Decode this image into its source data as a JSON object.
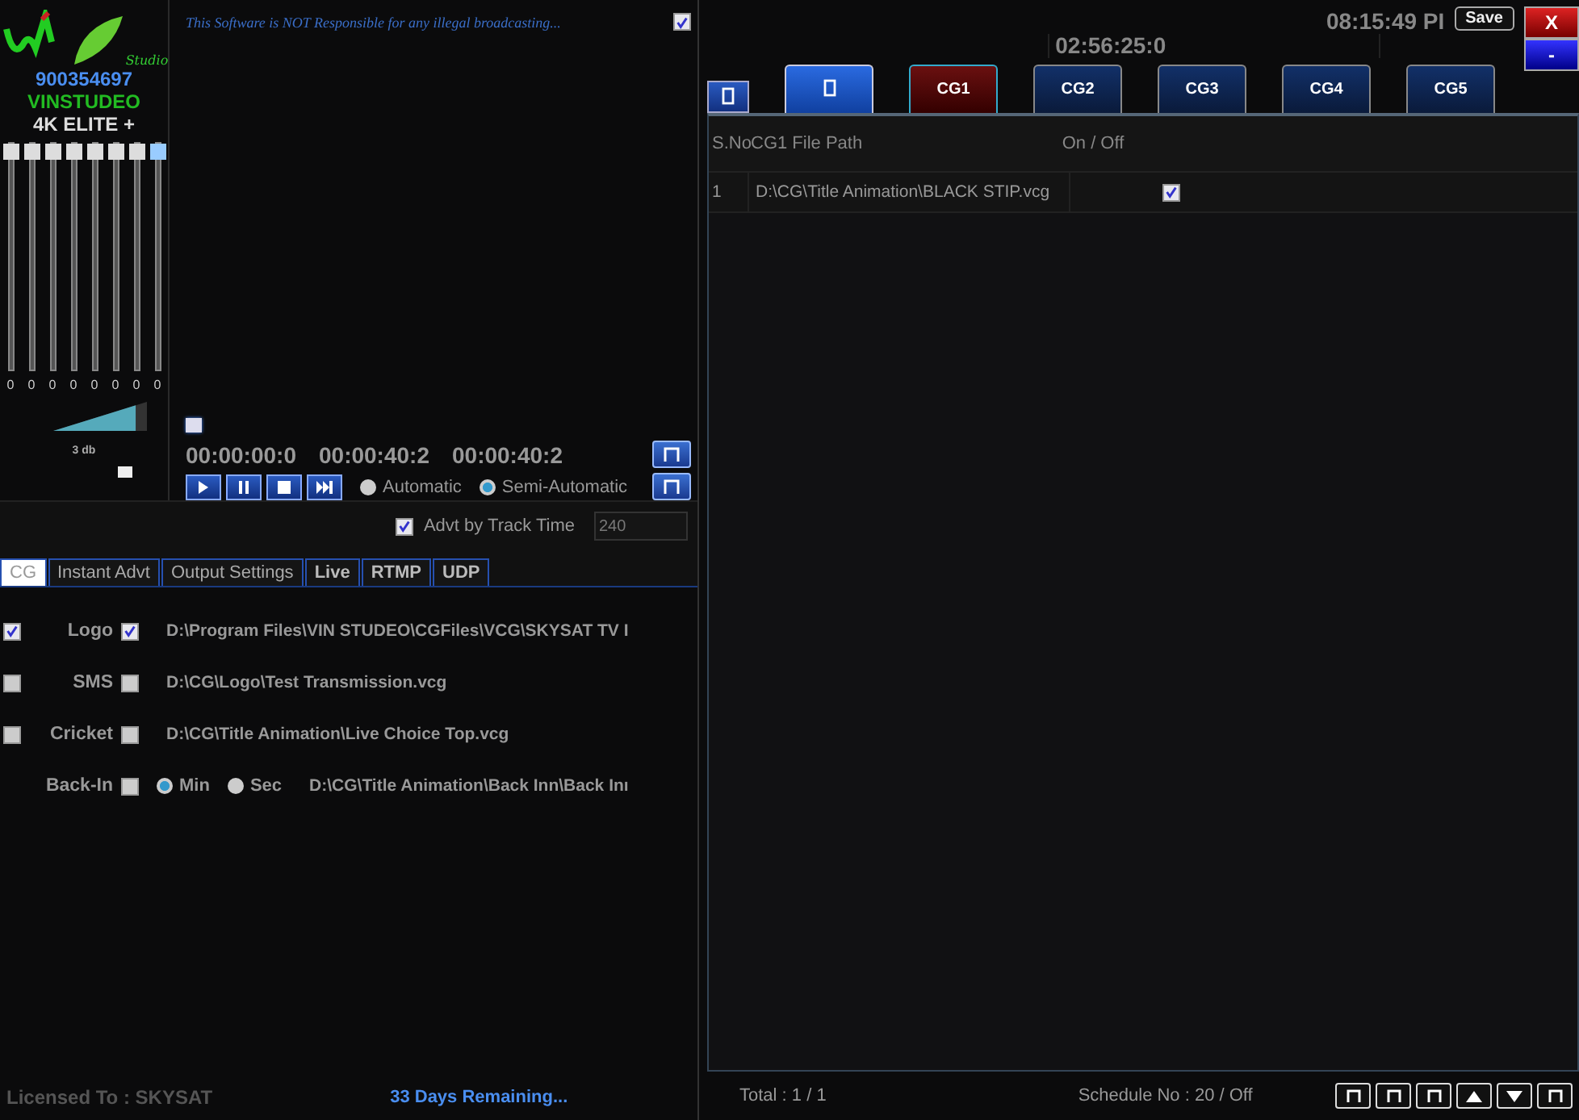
{
  "logo": {
    "tagline": "Studio",
    "number": "900354697",
    "brand": "VINSTUDEO",
    "edition": "4K ELITE +"
  },
  "disclaimer": {
    "text": "This Software is NOT Responsible for any illegal broadcasting...",
    "checked": true
  },
  "mixer": {
    "channels": [
      {
        "level": 1,
        "reading": "0"
      },
      {
        "level": 1,
        "reading": "0"
      },
      {
        "level": 1,
        "reading": "0"
      },
      {
        "level": 1,
        "reading": "0"
      },
      {
        "level": 1,
        "reading": "0"
      },
      {
        "level": 1,
        "reading": "0"
      },
      {
        "level": 1,
        "reading": "0"
      },
      {
        "level": 1,
        "reading": "0"
      }
    ],
    "volume": {
      "level": 0.88,
      "reading": "3 db"
    }
  },
  "playback": {
    "progress": {
      "level": 0
    },
    "timecodes": [
      "00:00:00:0",
      "00:00:40:2",
      "00:00:40:2"
    ],
    "modes": [
      {
        "label": "Automatic",
        "selected": false
      },
      {
        "label": "Semi-Automatic",
        "selected": true
      }
    ]
  },
  "advt": {
    "label": "Advt by Track Time",
    "checked": true,
    "value": "240"
  },
  "tabs": [
    {
      "label": "CG",
      "selected": true
    },
    {
      "label": "Instant Advt",
      "selected": false
    },
    {
      "label": "Output Settings",
      "selected": false
    },
    {
      "label": "Live",
      "selected": false
    },
    {
      "label": "RTMP",
      "selected": false
    },
    {
      "label": "UDP",
      "selected": false
    }
  ],
  "cg_rows": [
    {
      "kind": "check",
      "enabled": true,
      "label": "Logo",
      "checked": true,
      "path": "D:\\Program Files\\VIN STUDEO\\CGFiles\\VCG\\SKYSAT TV I"
    },
    {
      "kind": "check",
      "enabled": false,
      "label": "SMS",
      "checked": false,
      "path": "D:\\CG\\Logo\\Test Transmission.vcg"
    },
    {
      "kind": "check",
      "enabled": false,
      "label": "Cricket",
      "checked": false,
      "path": "D:\\CG\\Title Animation\\Live Choice Top.vcg"
    },
    {
      "kind": "radio",
      "label": "Back-In",
      "checked": false,
      "options": [
        {
          "label": "Min",
          "selected": true
        },
        {
          "label": "Sec",
          "selected": false
        }
      ],
      "path": "D:\\CG\\Title Animation\\Back Inn\\Back Inı"
    }
  ],
  "footer_left": {
    "license": "Licensed To : SKYSAT",
    "remaining": "33 Days Remaining..."
  },
  "clocks": [
    "08:15:49 PI",
    "02:56:25:0"
  ],
  "save_button": "Save",
  "window_buttons": [
    "X",
    "-"
  ],
  "cg_tabs": [
    {
      "label": "CG1",
      "selected": true
    },
    {
      "label": "CG2",
      "selected": false
    },
    {
      "label": "CG3",
      "selected": false
    },
    {
      "label": "CG4",
      "selected": false
    },
    {
      "label": "CG5",
      "selected": false
    }
  ],
  "table": {
    "columns": [
      "S.No",
      "CG1 File Path",
      "On / Off"
    ],
    "rows": [
      {
        "sno": "1",
        "path": "D:\\CG\\Title Animation\\BLACK STIP.vcg",
        "on": true
      }
    ]
  },
  "status_bar": {
    "total": "Total : 1 / 1",
    "schedule": "Schedule No : 20 / Off"
  }
}
